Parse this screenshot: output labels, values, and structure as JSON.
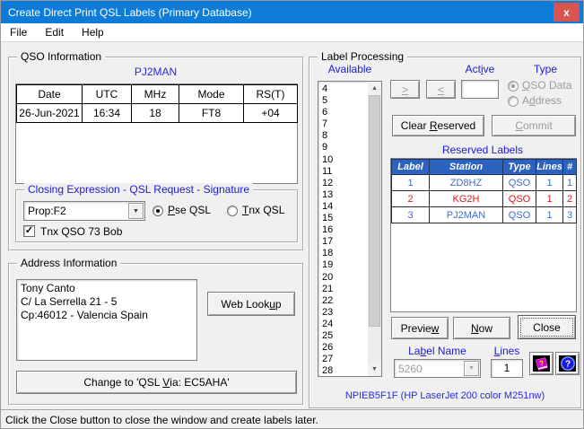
{
  "window": {
    "title": "Create Direct Print QSL Labels (Primary Database)"
  },
  "menu": {
    "items": [
      "File",
      "Edit",
      "Help"
    ]
  },
  "icons": {
    "close": "x",
    "dropdown_arrow": "▼",
    "scroll_up": "▲",
    "scroll_down": "▼",
    "check": "✓",
    "book_question": "?",
    "help_question": "?"
  },
  "colors": {
    "titlebar_blue": "#0c7cd8",
    "close_button_red": "#d9534f",
    "label_blue": "#1a1ad6",
    "table_header_blue": "#2d62c1",
    "row_text_blue": "#3a6cd4",
    "row_text_red": "#ee1111"
  },
  "qso_info": {
    "caption": "QSO Information",
    "callsign": "PJ2MAN",
    "table": {
      "headers": [
        "Date",
        "UTC",
        "MHz",
        "Mode",
        "RS(T)"
      ],
      "row": [
        "26-Jun-2021",
        "16:34",
        "18",
        "FT8",
        "+04"
      ]
    }
  },
  "closing": {
    "caption": "Closing Expression - QSL Request - Signature",
    "combo_value": "Prop:F2",
    "pse_qsl": {
      "pre": "",
      "key": "P",
      "post": "se QSL"
    },
    "tnx_qsl": {
      "pre": "",
      "key": "T",
      "post": "nx QSL"
    },
    "signature_checkbox": "Tnx QSO 73 Bob"
  },
  "address": {
    "caption": "Address Information",
    "lines": [
      "Tony Canto",
      "C/ La Serrella 21 - 5",
      "Cp:46012 - Valencia Spain"
    ],
    "web_lookup": {
      "pre": "Web Look",
      "key": "u",
      "post": "p"
    },
    "change_button": {
      "pre": "Change to 'QSL ",
      "key": "V",
      "post": "ia: EC5AHA'"
    }
  },
  "label_processing": {
    "caption": "Label Processing",
    "available_label": "Available",
    "available_items": [
      "4",
      "5",
      "6",
      "7",
      "8",
      "9",
      "10",
      "11",
      "12",
      "13",
      "14",
      "15",
      "16",
      "17",
      "18",
      "19",
      "20",
      "21",
      "22",
      "23",
      "24",
      "25",
      "26",
      "27",
      "28"
    ],
    "move_right": {
      "pre": "",
      "key": ">",
      "post": ""
    },
    "move_left": {
      "pre": "",
      "key": "<",
      "post": ""
    },
    "active_label": {
      "pre": "Act",
      "key": "i",
      "post": "ve"
    },
    "active_value": "",
    "type_label": "Type",
    "type_qso_data": {
      "pre": "",
      "key": "Q",
      "post": "SO Data"
    },
    "type_address": {
      "pre": "A",
      "key": "d",
      "post": "dress"
    },
    "clear_reserved": {
      "pre": "Clear ",
      "key": "R",
      "post": "eserved"
    },
    "commit": {
      "pre": "",
      "key": "C",
      "post": "ommit"
    },
    "reserved_caption": "Reserved Labels",
    "reserved_table": {
      "headers": [
        "Label",
        "Station",
        "Type",
        "Lines",
        "#"
      ],
      "rows": [
        {
          "label": "1",
          "station": "ZD8HZ",
          "type": "QSO",
          "lines": "1",
          "num": "1",
          "highlight": false
        },
        {
          "label": "2",
          "station": "KG2H",
          "type": "QSO",
          "lines": "1",
          "num": "2",
          "highlight": true
        },
        {
          "label": "3",
          "station": "PJ2MAN",
          "type": "QSO",
          "lines": "1",
          "num": "3",
          "highlight": false
        }
      ]
    },
    "preview": {
      "pre": "Previe",
      "key": "w",
      "post": ""
    },
    "now": {
      "pre": "",
      "key": "N",
      "post": "ow"
    },
    "close": "Close",
    "label_name": {
      "pre": "La",
      "key": "b",
      "post": "el Name"
    },
    "label_name_value": "5260",
    "lines_label": {
      "pre": "",
      "key": "L",
      "post": "ines"
    },
    "lines_value": "1",
    "printer": "NPIEB5F1F (HP LaserJet 200 color M251nw)"
  },
  "status_bar": "Click the Close button to close the window and create labels later."
}
